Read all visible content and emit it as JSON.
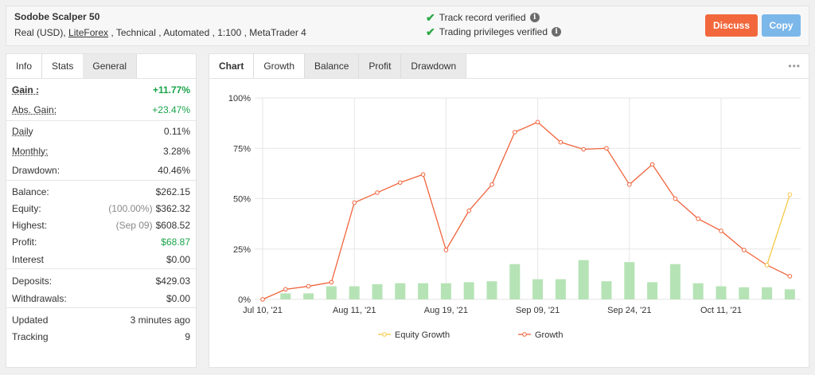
{
  "header": {
    "system_name": "Sodobe Scalper 50",
    "meta_prefix": "Real (USD), ",
    "broker": "LiteForex",
    "meta_suffix": " , Technical , Automated , 1:100 , MetaTrader 4",
    "verify_track": "Track record verified",
    "verify_trading": "Trading privileges verified",
    "discuss_label": "Discuss",
    "copy_label": "Copy",
    "check_icon": "check-icon",
    "info_icon": "info-icon"
  },
  "left_tabs": [
    "Info",
    "Stats",
    "General"
  ],
  "stats": {
    "gain": {
      "label": "Gain :",
      "value": "+11.77%"
    },
    "abs_gain": {
      "label": "Abs. Gain:",
      "value": "+23.47%"
    },
    "daily": {
      "label": "Daily",
      "value": "0.11%"
    },
    "monthly": {
      "label": "Monthly:",
      "value": "3.28%"
    },
    "drawdown": {
      "label": "Drawdown:",
      "value": "40.46%"
    },
    "balance": {
      "label": "Balance:",
      "value": "$262.15"
    },
    "equity": {
      "label": "Equity:",
      "note": "(100.00%)",
      "value": "$362.32"
    },
    "highest": {
      "label": "Highest:",
      "note": "(Sep 09)",
      "value": "$608.52"
    },
    "profit": {
      "label": "Profit:",
      "value": "$68.87"
    },
    "interest": {
      "label": "Interest",
      "value": "$0.00"
    },
    "deposits": {
      "label": "Deposits:",
      "value": "$429.03"
    },
    "withdrawals": {
      "label": "Withdrawals:",
      "value": "$0.00"
    },
    "updated": {
      "label": "Updated",
      "value": "3 minutes ago"
    },
    "tracking": {
      "label": "Tracking",
      "value": "9"
    }
  },
  "chart_tabs": [
    "Chart",
    "Growth",
    "Balance",
    "Profit",
    "Drawdown"
  ],
  "chart_more": "•••",
  "colors": {
    "growth": "#f0643c",
    "equity": "#f7c948",
    "bars": "#b5e3b5",
    "gain_green": "#1aa34a"
  },
  "chart_data": {
    "type": "line",
    "ylim": [
      0,
      100
    ],
    "y_ticks": [
      "0%",
      "25%",
      "50%",
      "75%",
      "100%"
    ],
    "x_ticks": [
      "Jul 10, '21",
      "Aug 11, '21",
      "Aug 19, '21",
      "Sep 09, '21",
      "Sep 24, '21",
      "Oct 11, '21"
    ],
    "x_tick_index": [
      0,
      4,
      8,
      12,
      16,
      20
    ],
    "points_count": 24,
    "series": [
      {
        "name": "Growth",
        "values": [
          0,
          5,
          6.5,
          8.5,
          48,
          53,
          58,
          62,
          24.5,
          44,
          57,
          83,
          88,
          78,
          74.5,
          75,
          57,
          67,
          50,
          40,
          34,
          24.5,
          17,
          11.5
        ]
      },
      {
        "name": "Equity Growth",
        "values": [
          null,
          null,
          null,
          null,
          null,
          null,
          null,
          null,
          null,
          null,
          null,
          null,
          null,
          null,
          null,
          null,
          null,
          null,
          null,
          null,
          null,
          null,
          17,
          52
        ]
      }
    ],
    "bars": [
      0,
      3,
      3,
      6.5,
      6.5,
      7.5,
      8,
      8,
      8,
      8.5,
      9,
      17.5,
      10,
      10,
      19.5,
      9,
      18.5,
      8.5,
      17.5,
      8,
      6.5,
      6,
      6,
      5
    ],
    "legend": [
      "Equity Growth",
      "Growth"
    ]
  }
}
